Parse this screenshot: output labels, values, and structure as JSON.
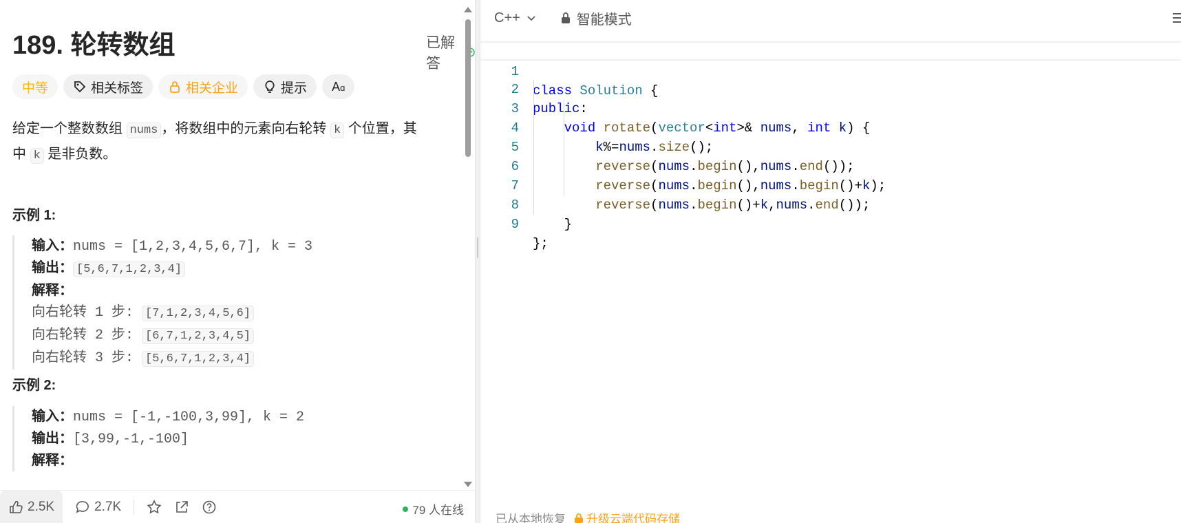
{
  "problem": {
    "title": "189. 轮转数组",
    "status": "已解答",
    "tags": [
      "中等",
      "相关标签",
      "相关企业",
      "提示",
      "A文"
    ],
    "desc_part1": "给定一个整数数组 ",
    "desc_code1": "nums",
    "desc_part2": "，将数组中的元素向右轮转 ",
    "desc_code2": "k",
    "desc_part3": " 个位置，其",
    "desc_part4": "中 ",
    "desc_code3": "k",
    "desc_part5": " 是非负数。"
  },
  "example1": {
    "heading": "示例 1:",
    "input_label": "输入：",
    "input_value": "nums = [1,2,3,4,5,6,7], k = 3",
    "output_label": "输出：",
    "output_value": "[5,6,7,1,2,3,4]",
    "explain_label": "解释：",
    "steps": [
      {
        "text": "向右轮转 1 步: ",
        "value": "[7,1,2,3,4,5,6]"
      },
      {
        "text": "向右轮转 2 步: ",
        "value": "[6,7,1,2,3,4,5]"
      },
      {
        "text": "向右轮转 3 步: ",
        "value": "[5,6,7,1,2,3,4]"
      }
    ]
  },
  "example2": {
    "heading": "示例 2:",
    "input_label": "输入：",
    "input_value": "nums = [-1,-100,3,99], k = 2",
    "output_label": "输出：",
    "output_value": "[3,99,-1,-100]",
    "explain_label": "解释："
  },
  "bottombar": {
    "likes": "2.5K",
    "comments": "2.7K",
    "online": "79 人在线"
  },
  "editor": {
    "language": "C++",
    "mode": "智能模式",
    "line_numbers": [
      "1",
      "2",
      "3",
      "4",
      "5",
      "6",
      "7",
      "8",
      "9"
    ],
    "footer_restored": "已从本地恢复",
    "footer_upgrade": "升级云端代码存储"
  },
  "colors": {
    "accent": "#ffa116",
    "medium": "#ffb800",
    "online_dot": "#2db55d",
    "solved_check": "#2db55d"
  }
}
